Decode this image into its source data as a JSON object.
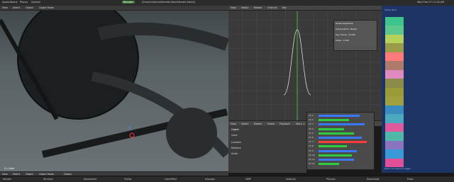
{
  "topbar": {
    "menus": [
      "Applications",
      "Places",
      "System"
    ],
    "title": "Blender",
    "file_path": "[/home/ubuntu/blender/dev/blender.blend]",
    "clock": "Wed Feb 23 11:18 AM"
  },
  "viewport": {
    "header_items": [
      "View",
      "Select",
      "Object",
      "Object Mode"
    ],
    "footer_items": [
      "View",
      "Select",
      "Object",
      "Object Mode",
      "Global"
    ],
    "object_label": "(1) Cube"
  },
  "graph_editor": {
    "header_items": [
      "View",
      "Select",
      "Marker",
      "Channel",
      "Key"
    ],
    "toolbar_items": [
      "View",
      "Select",
      "Marker",
      "Frame",
      "Playback",
      "Start: 1",
      "End: 250",
      "1"
    ],
    "y_labels": [
      "1.000",
      "0.800",
      "0.600",
      "0.400",
      "0.200",
      "0.000"
    ],
    "x_labels": [
      "-20",
      "0",
      "20",
      "40",
      "60",
      "80",
      "100",
      "120",
      "140",
      "160",
      "180",
      "200",
      "220",
      "240"
    ]
  },
  "floating_panel": {
    "title": "Active Keyframe",
    "field1": "Interpolation: Bezier",
    "field2": "Key Frame: 70.000",
    "field3": "Value: 1.000"
  },
  "properties": {
    "title": "Object",
    "tabs": [
      "Cube"
    ],
    "fields": [
      "Location",
      "Rotation",
      "Scale"
    ]
  },
  "sequencer": {
    "rows": [
      {
        "label": "Ch 1",
        "color": "#3a78ff",
        "value": 0.8
      },
      {
        "label": "Ch 2",
        "color": "#2ecc40",
        "value": 0.6
      },
      {
        "label": "Ch 3",
        "color": "#3a78ff",
        "value": 0.9
      },
      {
        "label": "Ch 4",
        "color": "#2ecc40",
        "value": 0.5
      },
      {
        "label": "Ch 5",
        "color": "#2ecc40",
        "value": 0.7
      },
      {
        "label": "Ch 6",
        "color": "#3a78ff",
        "value": 0.85
      },
      {
        "label": "Ch 7",
        "color": "#ff3a3a",
        "value": 0.95
      },
      {
        "label": "Ch 8",
        "color": "#2ecc40",
        "value": 0.55
      },
      {
        "label": "Ch 9",
        "color": "#3a78ff",
        "value": 0.75
      },
      {
        "label": "Ch 10",
        "color": "#2ecc40",
        "value": 0.65
      },
      {
        "label": "Ch 11",
        "color": "#3a78ff",
        "value": 0.7
      },
      {
        "label": "Ch 12",
        "color": "#2ecc40",
        "value": 0.4
      }
    ]
  },
  "right_panel": {
    "header": "Vertex Paint",
    "footer": "Press ctrl+space to toggle",
    "swatches": [
      "#3cc48a",
      "#5cc88e",
      "#b6d25a",
      "#9b9b4a",
      "#ff7a7a",
      "#b07a6a",
      "#e08ac0",
      "#8c8c4a",
      "#9a9a36",
      "#a0a040",
      "#3a8cc0",
      "#4aa8c0",
      "#e05aa0",
      "#50b8a8",
      "#8a74c0",
      "#3a9ad8",
      "#e0509a"
    ]
  },
  "taskbar": {
    "items": [
      "blender",
      "Terminal",
      "Documents",
      "Firefox",
      "LibreOffice",
      "Inkscape",
      "GIMP",
      "Audacity",
      "Pictures",
      "Downloads",
      "Music"
    ]
  }
}
